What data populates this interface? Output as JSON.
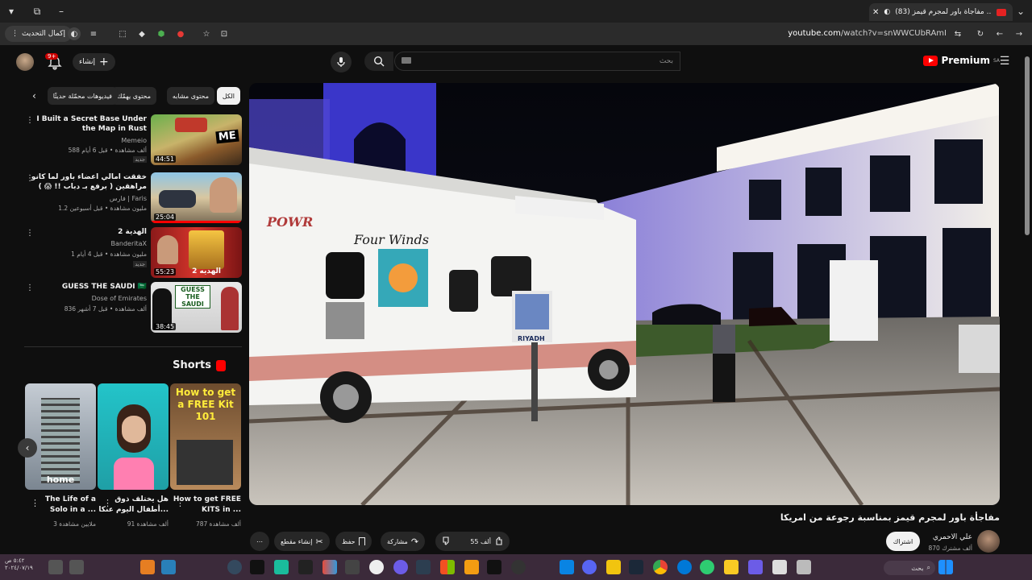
{
  "browser": {
    "tab_title": "(83) مفاجأة باور لمجرم قيمز ...",
    "url_host": "youtube.com",
    "url_path": "/watch?v=snWWCUbRAmI",
    "update_label": "إكمال التحديث"
  },
  "header": {
    "brand": "Premium",
    "brand_region": "SA",
    "search_placeholder": "بحث",
    "create_label": "إنشاء",
    "notif_count": "9+"
  },
  "chips": [
    "الكل",
    "محتوى مشابه",
    "محتوى يهمّك",
    "فيديوهات محمّلة حديثًا"
  ],
  "related": [
    {
      "title": "I Built a Secret Base Under the Map in Rust",
      "channel": "Memeio",
      "meta": "588 ألف مشاهدة • قبل 6 أيام",
      "badge": "جديد",
      "duration": "44:51",
      "thumb_text": "ME"
    },
    {
      "title": "خفقت امالي اعضاء باور لما كانو مراهقين ( برفع بـ دباب !! 😱 )",
      "channel": "فارس | Faris",
      "meta": "1.2 مليون مشاهدة • قبل أسبوعين",
      "badge": "",
      "duration": "25:04",
      "thumb_text": ""
    },
    {
      "title": "الهدية 2",
      "channel": "BanderitaX",
      "meta": "1 مليون مشاهدة • قبل 4 أيام",
      "badge": "جديد",
      "duration": "55:23",
      "thumb_text": "الهديه 2"
    },
    {
      "title": "GUESS THE SAUDI 🇸🇦",
      "channel": "Dose of Emirates",
      "meta": "836 ألف مشاهدة • قبل 7 أشهر",
      "badge": "",
      "duration": "38:45",
      "thumb_text": "GUESS THE SAUDI"
    }
  ],
  "shorts": {
    "heading": "Shorts",
    "items": [
      {
        "title": "How to get FREE KITS in ...",
        "views": "787 ألف مشاهدة",
        "thumb_text": "How to get a FREE Kit 101"
      },
      {
        "title": "هل يختلف ذوق أطفال اليوم عنكا...",
        "views": "91 ألف مشاهدة",
        "thumb_text": ""
      },
      {
        "title": "The Life of a Solo in a ...",
        "views": "3 ملايين مشاهدة",
        "thumb_text": "home"
      }
    ]
  },
  "video": {
    "title": "مفاجأة باور لمجرم قيمز بمناسبة رجوعة من امريكا",
    "channel": "علي الاحمري",
    "subscribers": "870 ألف مشترك",
    "subscribe_label": "اشتراك",
    "likes": "55 ألف",
    "share_label": "مشاركة",
    "save_label": "حفظ",
    "clip_label": "إنشاء مقطع",
    "scene": {
      "rv_brand": "POWR",
      "rv_model": "Four Winds",
      "sign_text": "RIYADH"
    }
  },
  "taskbar": {
    "time": "٥:٤٢ ص",
    "date": "٢٠٢٤/٠٧/١٩",
    "search_label": "بحث"
  }
}
